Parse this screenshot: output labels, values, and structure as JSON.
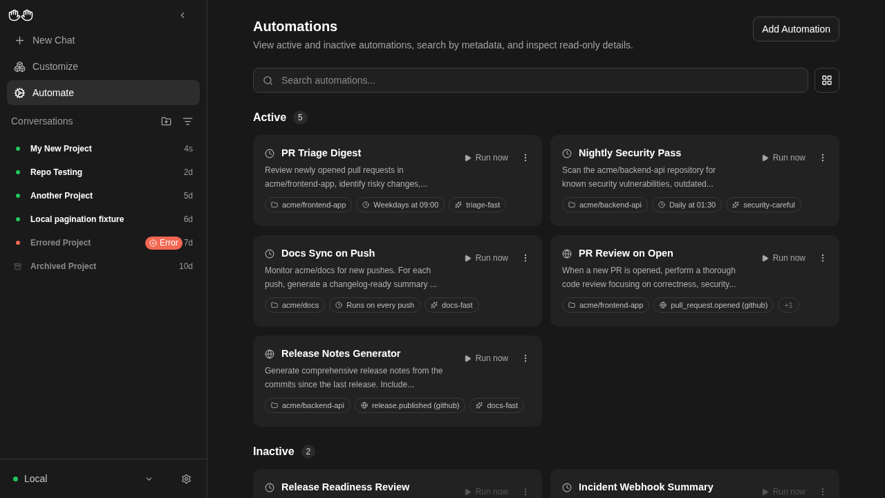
{
  "sidebar": {
    "nav": [
      {
        "label": "New Chat",
        "kind": "plus",
        "selected": false
      },
      {
        "label": "Customize",
        "kind": "cubes",
        "selected": false
      },
      {
        "label": "Automate",
        "kind": "gear",
        "selected": true
      }
    ],
    "conversations_title": "Conversations",
    "conversations": [
      {
        "name": "My New Project",
        "kind": "running",
        "age": "4s"
      },
      {
        "name": "Repo Testing",
        "kind": "running",
        "age": "2d"
      },
      {
        "name": "Another Project",
        "kind": "running",
        "age": "5d"
      },
      {
        "name": "Local pagination fixture",
        "kind": "running",
        "age": "6d"
      },
      {
        "name": "Errored Project",
        "kind": "error",
        "age": "7d",
        "badge": "Error"
      },
      {
        "name": "Archived Project",
        "kind": "archived",
        "age": "10d"
      }
    ],
    "footer": {
      "label": "Local",
      "online": true
    }
  },
  "page": {
    "title": "Automations",
    "subtitle": "View active and inactive automations, search by metadata, and inspect read-only details.",
    "add_button": "Add Automation",
    "search": {
      "placeholder": "Search automations..."
    }
  },
  "sections": [
    {
      "title": "Active",
      "count": "5",
      "active": true,
      "cards": [
        {
          "kind": "scheduled",
          "title": "PR Triage Digest",
          "run": "Run now",
          "description": "Review newly opened pull requests in acme/frontend-app, identify risky changes,...",
          "chips": [
            {
              "kind": "repo",
              "label": "acme/frontend-app"
            },
            {
              "kind": "schedule",
              "label": "Weekdays at 09:00"
            },
            {
              "kind": "model",
              "label": "triage-fast"
            }
          ]
        },
        {
          "kind": "scheduled",
          "title": "Nightly Security Pass",
          "run": "Run now",
          "description": "Scan the acme/backend-api repository for known security vulnerabilities, outdated...",
          "chips": [
            {
              "kind": "repo",
              "label": "acme/backend-api"
            },
            {
              "kind": "schedule",
              "label": "Daily at 01:30"
            },
            {
              "kind": "model",
              "label": "security-careful"
            }
          ]
        },
        {
          "kind": "scheduled",
          "title": "Docs Sync on Push",
          "run": "Run now",
          "description": "Monitor acme/docs for new pushes. For each push, generate a changelog-ready summary ...",
          "chips": [
            {
              "kind": "repo",
              "label": "acme/docs"
            },
            {
              "kind": "schedule",
              "label": "Runs on every push"
            },
            {
              "kind": "model",
              "label": "docs-fast"
            }
          ]
        },
        {
          "kind": "webhook",
          "title": "PR Review on Open",
          "run": "Run now",
          "description": "When a new PR is opened, perform a thorough code review focusing on correctness, security...",
          "chips": [
            {
              "kind": "repo",
              "label": "acme/frontend-app"
            },
            {
              "kind": "trigger",
              "label": "pull_request.opened (github)"
            },
            {
              "kind": "more",
              "label": "+1"
            }
          ]
        },
        {
          "kind": "webhook",
          "title": "Release Notes Generator",
          "run": "Run now",
          "description": "Generate comprehensive release notes from the commits since the last release. Include...",
          "chips": [
            {
              "kind": "repo",
              "label": "acme/backend-api"
            },
            {
              "kind": "trigger",
              "label": "release.published (github)"
            },
            {
              "kind": "model",
              "label": "docs-fast"
            }
          ]
        }
      ]
    },
    {
      "title": "Inactive",
      "count": "2",
      "active": false,
      "cards": [
        {
          "kind": "scheduled",
          "title": "Release Readiness Review",
          "run": "Run now"
        },
        {
          "kind": "scheduled",
          "title": "Incident Webhook Summary",
          "run": "Run now"
        }
      ]
    }
  ]
}
